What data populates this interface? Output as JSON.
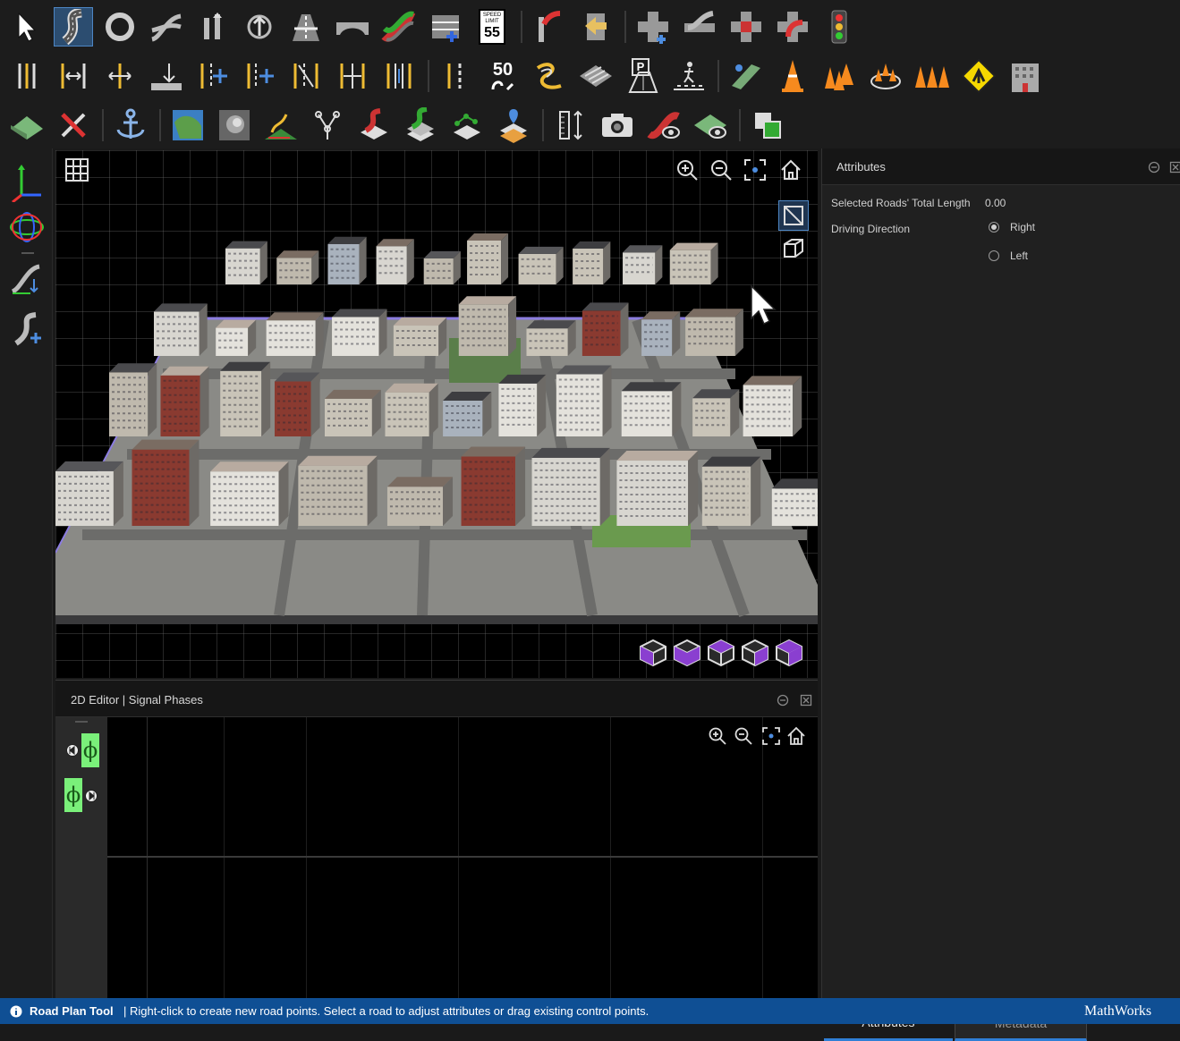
{
  "toolbar": {
    "speed_limit_sign": {
      "top": "SPEED",
      "mid": "LIMIT",
      "value": "55"
    },
    "speed_marking_value": "50",
    "parking_letter": "P"
  },
  "viewport3d": {
    "toolbar_icons": [
      "zoom-in-icon",
      "zoom-out-icon",
      "fit-view-icon",
      "home-icon"
    ],
    "view_modes": [
      "ortho-view-icon",
      "perspective-view-icon"
    ],
    "view_cubes": [
      "view-cube-1",
      "view-cube-2",
      "view-cube-3",
      "view-cube-4",
      "view-cube-5"
    ]
  },
  "attributes": {
    "title": "Attributes",
    "selected_length_label": "Selected Roads' Total Length",
    "selected_length_value": "0.00",
    "driving_direction_label": "Driving Direction",
    "options": [
      "Right",
      "Left"
    ],
    "selected": "Right"
  },
  "bottom_tabs": [
    "Attributes",
    "Metadata"
  ],
  "active_tab": "Attributes",
  "editor2d": {
    "tabs": "2D Editor | Signal Phases",
    "phase_symbol": "ϕ"
  },
  "status": {
    "tool": "Road Plan Tool",
    "message": "| Right-click to create new road points. Select a road to adjust attributes or drag existing control points.",
    "brand": "MathWorks"
  },
  "colors": {
    "accent": "#0f4f94",
    "active_tool": "#2c4d70",
    "phase": "#7af07a",
    "view_cube": "#8a3fd0"
  }
}
